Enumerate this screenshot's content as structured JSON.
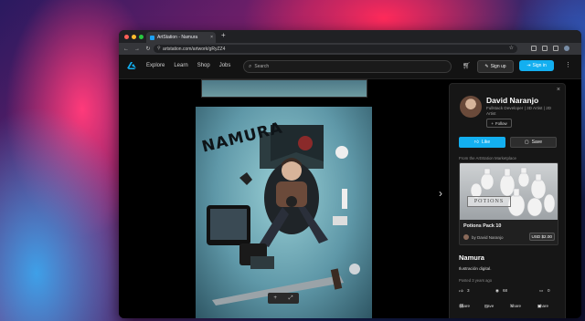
{
  "browser": {
    "tab_title": "ArtStation - Namura",
    "tab_close": "×",
    "new_tab": "+",
    "url": "artstation.com/artwork/gRyZZ4"
  },
  "site": {
    "nav": [
      "Explore",
      "Learn",
      "Shop",
      "Jobs"
    ],
    "search_placeholder": "Search",
    "signup_label": "Sign up",
    "signin_label": "Sign in"
  },
  "artwork": {
    "art_text": "NAMURA",
    "title": "Namura",
    "description": "Ilustración digital.",
    "posted": "Posted 3 years ago",
    "likes": "3",
    "views": "68",
    "comments": "0"
  },
  "artist": {
    "name": "David Naranjo",
    "bio": "Fullstack Developer | 3D Artist | 2D Artist",
    "follow_label": "Follow"
  },
  "actions": {
    "like_label": "Like",
    "save_label": "Save"
  },
  "marketplace": {
    "heading": "From the ArtStation Marketplace",
    "product_image_text": "POTIONS",
    "product_title": "Potions Pack 10",
    "seller": "by David Naranjo",
    "price": "USD $2.00"
  },
  "share_bar": {
    "share": "Share",
    "save": "Save",
    "share_x": "Share",
    "share_other": "Share"
  },
  "colors": {
    "accent": "#13aff0"
  }
}
